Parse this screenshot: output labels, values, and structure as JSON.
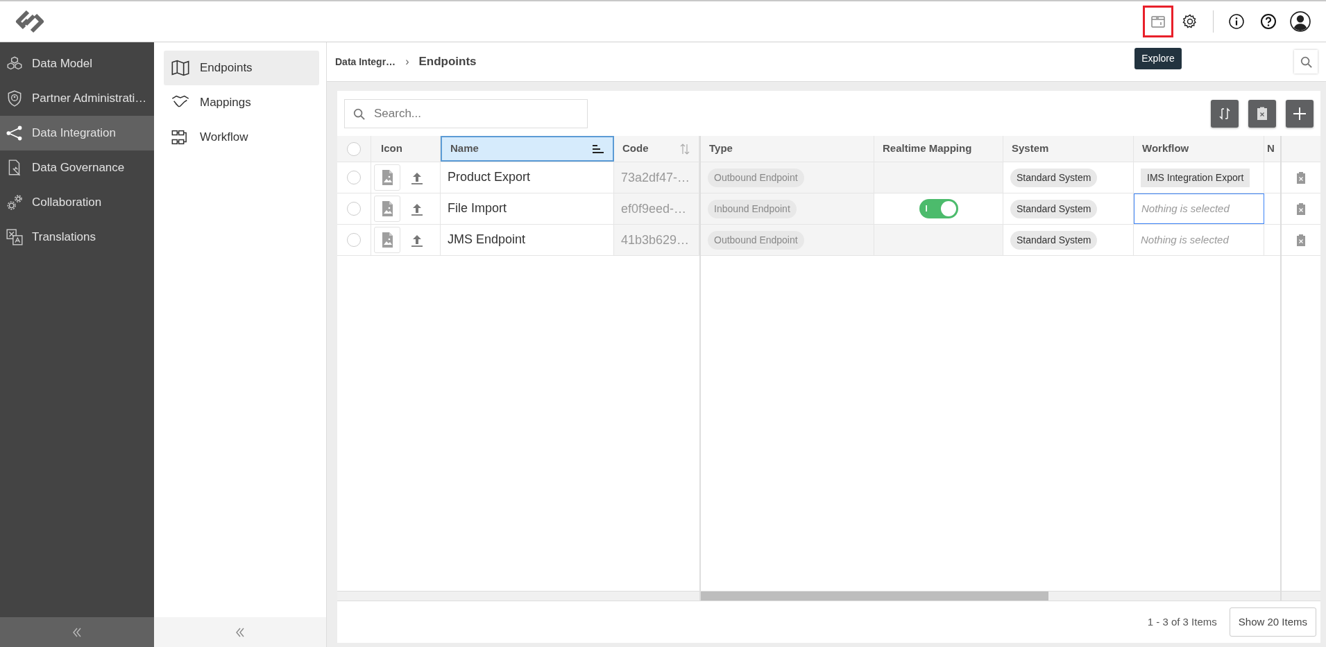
{
  "header": {
    "actions": [
      {
        "kind": "explore",
        "highlighted": true,
        "tooltip": "Explore"
      },
      {
        "kind": "settings",
        "highlighted": false
      },
      {
        "kind": "info",
        "highlighted": false
      },
      {
        "kind": "help",
        "highlighted": false
      },
      {
        "kind": "user",
        "highlighted": false
      }
    ]
  },
  "sidebar": {
    "items": [
      {
        "kind": "cubes",
        "label": "Data Model",
        "selected": false
      },
      {
        "kind": "shield",
        "label": "Partner Administrati…",
        "selected": false
      },
      {
        "kind": "nodes",
        "label": "Data Integration",
        "selected": true
      },
      {
        "kind": "governance",
        "label": "Data Governance",
        "selected": false
      },
      {
        "kind": "gears",
        "label": "Collaboration",
        "selected": false
      },
      {
        "kind": "translate",
        "label": "Translations",
        "selected": false
      }
    ]
  },
  "subnav": {
    "items": [
      {
        "kind": "map",
        "label": "Endpoints",
        "selected": true
      },
      {
        "kind": "handshake",
        "label": "Mappings",
        "selected": false
      },
      {
        "kind": "flow",
        "label": "Workflow",
        "selected": false
      }
    ]
  },
  "breadcrumb": {
    "items": [
      "Data Integr…",
      "Endpoints"
    ],
    "separator": "›"
  },
  "toolbar": {
    "search": {
      "placeholder": "Search..."
    },
    "buttons": [
      {
        "kind": "refresh"
      },
      {
        "kind": "delete"
      },
      {
        "kind": "add"
      }
    ]
  },
  "table": {
    "all_selected": false,
    "columns": [
      {
        "label": "Icon",
        "sorted": false,
        "sortable": false
      },
      {
        "label": "Name",
        "sorted": true
      },
      {
        "label": "Code",
        "sorted": false,
        "sortable": true
      },
      {
        "label": "Type",
        "sorted": false,
        "sortable": false
      },
      {
        "label": "Realtime Mapping",
        "sorted": false,
        "sortable": false
      },
      {
        "label": "System",
        "sorted": false,
        "sortable": false
      },
      {
        "label": "Workflow",
        "sorted": false,
        "sortable": false
      },
      {
        "label": "N",
        "sorted": false,
        "sortable": false
      }
    ],
    "rows": [
      {
        "selected": false,
        "name": "Product Export",
        "code": "73a2df47-…",
        "type": "Outbound Endpoint",
        "system": "Standard System",
        "workflow": {
          "kind": "chip",
          "text": "IMS Integration Export",
          "focused": false
        }
      },
      {
        "selected": false,
        "name": "File Import",
        "code": "ef0f9eed-…",
        "type": "Inbound Endpoint",
        "realtime_mapping": {
          "on": true,
          "label": "I"
        },
        "system": "Standard System",
        "workflow": {
          "kind": "empty",
          "text": "Nothing is selected",
          "focused": true
        }
      },
      {
        "selected": false,
        "name": "JMS Endpoint",
        "code": "41b3b629…",
        "type": "Outbound Endpoint",
        "system": "Standard System",
        "workflow": {
          "kind": "empty",
          "text": "Nothing is selected",
          "focused": false
        }
      }
    ],
    "scroll": {
      "level": 0.6
    }
  },
  "footer": {
    "summary": "1 - 3 of 3 Items",
    "page_size_button": "Show 20 Items"
  }
}
